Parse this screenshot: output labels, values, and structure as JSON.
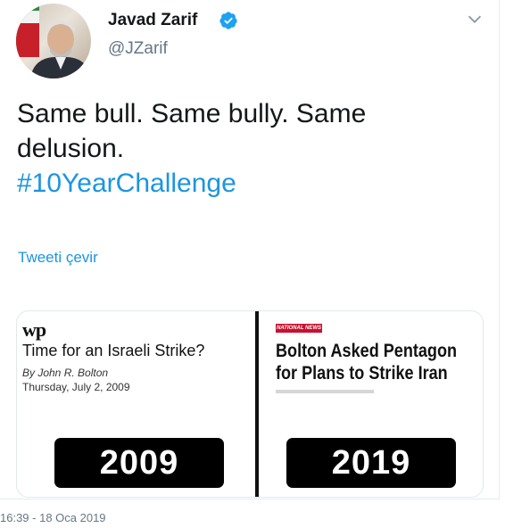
{
  "tweet": {
    "author": {
      "display_name": "Javad Zarif",
      "handle": "@JZarif",
      "verified": true
    },
    "text_lines": [
      "Same bull.  Same bully.  Same",
      "delusion."
    ],
    "hashtag": "#10YearChallenge",
    "translate_label": "Tweeti çevir",
    "timestamp": "16:39 - 18 Oca 2019",
    "colors": {
      "link": "#1b95e0",
      "secondary_text": "#657786",
      "primary_text": "#14171a"
    },
    "icons": {
      "verified": "verified-badge-icon",
      "caret": "chevron-down-icon"
    }
  },
  "media": {
    "left": {
      "logo": "wp",
      "headline": "Time for an Israeli Strike?",
      "byline": "By John R. Bolton",
      "date": "Thursday, July 2, 2009",
      "year": "2009"
    },
    "right": {
      "tag": "NATIONAL NEWS",
      "headline_lines": [
        "Bolton Asked Pentagon",
        "for Plans to Strike Iran"
      ],
      "year": "2019"
    }
  }
}
